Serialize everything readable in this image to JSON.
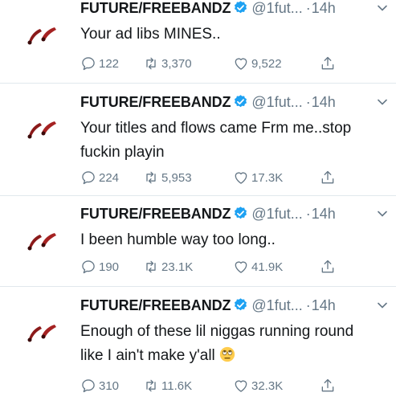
{
  "tweets": [
    {
      "name": "FUTURE/FREEBANDZ",
      "handle": "@1fut...",
      "dot": "·",
      "time": "14h",
      "text": "Your ad libs MINES..",
      "replies": "122",
      "retweets": "3,370",
      "likes": "9,522"
    },
    {
      "name": "FUTURE/FREEBANDZ",
      "handle": "@1fut...",
      "dot": "·",
      "time": "14h",
      "text": "Your titles and flows came Frm me..stop fuckin playin",
      "replies": "224",
      "retweets": "5,953",
      "likes": "17.3K"
    },
    {
      "name": "FUTURE/FREEBANDZ",
      "handle": "@1fut...",
      "dot": "·",
      "time": "14h",
      "text": "I been humble way too long..",
      "replies": "190",
      "retweets": "23.1K",
      "likes": "41.9K"
    },
    {
      "name": "FUTURE/FREEBANDZ",
      "handle": "@1fut...",
      "dot": "·",
      "time": "14h",
      "text": "Enough of these lil niggas running round like I ain't make y'all",
      "replies": "310",
      "retweets": "11.6K",
      "likes": "32.3K"
    }
  ],
  "colors": {
    "name": "#14171a",
    "muted": "#657786",
    "verified": "#1da1f2",
    "divider": "#e1e8ed",
    "avatar": "#8b1a1a"
  },
  "icons": {
    "verified": "verified-badge-icon",
    "caret": "chevron-down-icon",
    "reply": "reply-icon",
    "retweet": "retweet-icon",
    "like": "heart-icon",
    "share": "share-icon",
    "emoji": "eye-roll-emoji-icon"
  }
}
